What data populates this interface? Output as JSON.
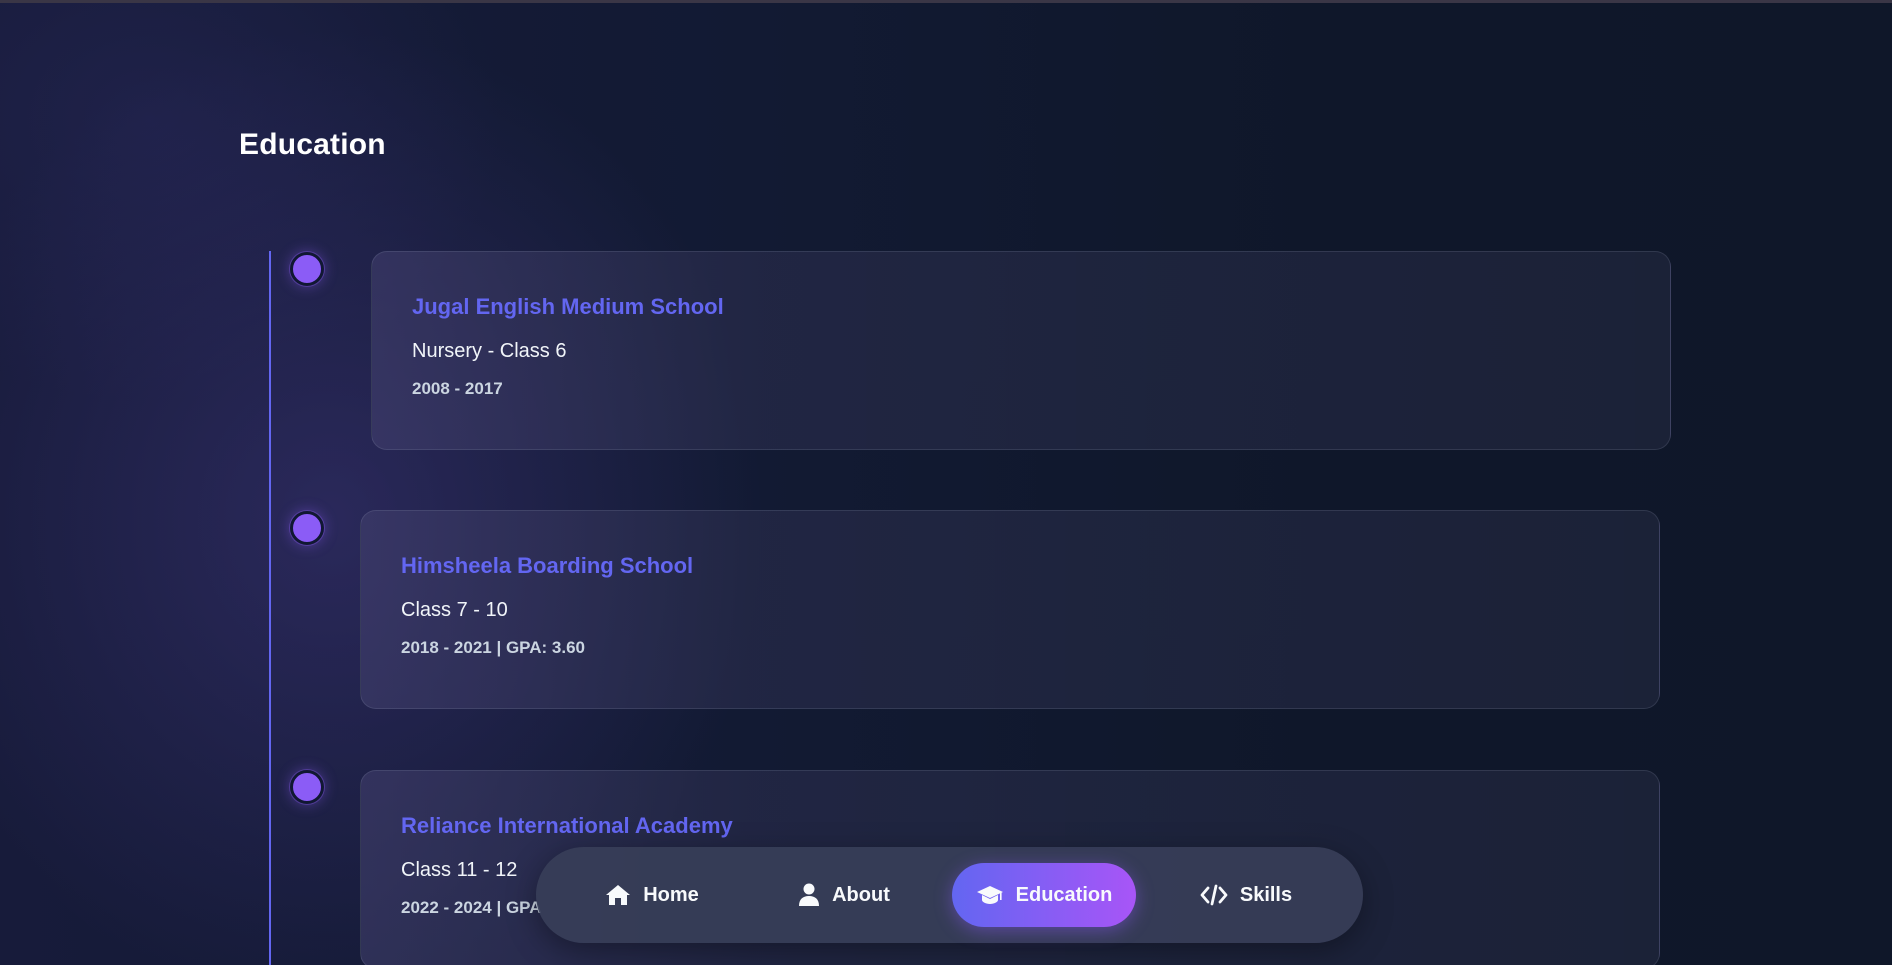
{
  "section": {
    "title": "Education"
  },
  "education": [
    {
      "school": "Jugal English Medium School",
      "grade": "Nursery - Class 6",
      "meta": "2008 - 2017"
    },
    {
      "school": "Himsheela Boarding School",
      "grade": "Class 7 - 10",
      "meta": "2018 - 2021 | GPA: 3.60"
    },
    {
      "school": "Reliance International Academy",
      "grade": "Class 11 - 12",
      "meta": "2022 - 2024 | GPA"
    }
  ],
  "nav": {
    "items": [
      {
        "label": "Home",
        "icon": "home-icon"
      },
      {
        "label": "About",
        "icon": "user-icon"
      },
      {
        "label": "Education",
        "icon": "graduation-cap-icon",
        "active": true
      },
      {
        "label": "Skills",
        "icon": "code-icon"
      }
    ]
  },
  "colors": {
    "accent": "#6366f1",
    "dot": "#8b5cf6",
    "active_gradient_end": "#a855f7",
    "background": "#0f172a"
  }
}
